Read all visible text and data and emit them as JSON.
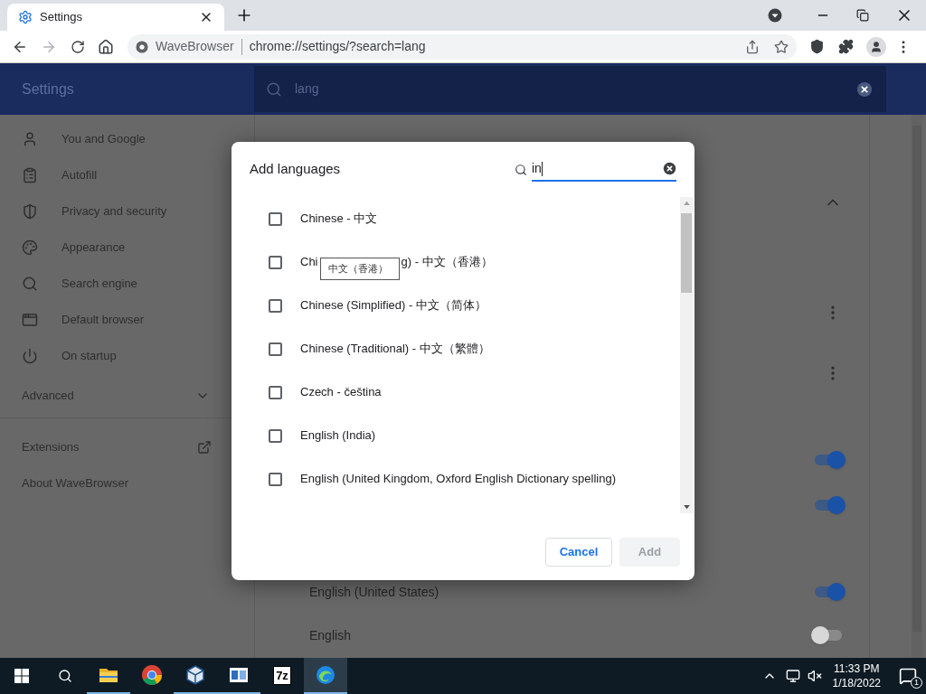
{
  "browser": {
    "tabs": [
      {
        "title": "Settings",
        "selected": true
      }
    ],
    "site_name": "WaveBrowser",
    "url": "chrome://settings/?search=lang"
  },
  "settings_header": {
    "title": "Settings",
    "search_value": "lang"
  },
  "sidebar": {
    "items": [
      {
        "label": "You and Google",
        "kind": "person"
      },
      {
        "label": "Autofill",
        "kind": "clipboard"
      },
      {
        "label": "Privacy and security",
        "kind": "shield"
      },
      {
        "label": "Appearance",
        "kind": "palette"
      },
      {
        "label": "Search engine",
        "kind": "search"
      },
      {
        "label": "Default browser",
        "kind": "browser"
      },
      {
        "label": "On startup",
        "kind": "power"
      }
    ],
    "advanced": {
      "label": "Advanced",
      "expanded": false
    },
    "links": [
      {
        "label": "Extensions",
        "external": true
      },
      {
        "label": "About WaveBrowser",
        "external": false
      }
    ]
  },
  "background_rows": [
    {
      "kind": "collapse"
    },
    {
      "kind": "menu"
    },
    {
      "kind": "menu"
    },
    {
      "kind": "toggle",
      "on": true
    },
    {
      "kind": "toggle",
      "on": true
    },
    {
      "kind": "toggle",
      "label": "English (United States)",
      "on": true
    },
    {
      "kind": "toggle",
      "label": "English",
      "on": false
    }
  ],
  "dialog": {
    "title": "Add languages",
    "search_value": "in",
    "languages": [
      {
        "label": "Chinese - 中文",
        "checked": false
      },
      {
        "label_start": "Chi",
        "tooltip": "中文（香港）",
        "label_end": "g) - 中文（香港）",
        "checked": false
      },
      {
        "label": "Chinese (Simplified) - 中文（简体）",
        "checked": false
      },
      {
        "label": "Chinese (Traditional) - 中文（繁體）",
        "checked": false
      },
      {
        "label": "Czech - čeština",
        "checked": false
      },
      {
        "label": "English (India)",
        "checked": false
      },
      {
        "label": "English (United Kingdom, Oxford English Dictionary spelling)",
        "checked": false
      }
    ],
    "buttons": [
      {
        "label": "Cancel",
        "kind": "secondary",
        "disabled": false
      },
      {
        "label": "Add",
        "kind": "primary",
        "disabled": true
      }
    ]
  },
  "taskbar": {
    "apps": [
      {
        "kind": "explorer",
        "running": true,
        "selected": false
      },
      {
        "kind": "chrome",
        "running": false,
        "selected": false
      },
      {
        "kind": "cube",
        "running": true,
        "selected": false
      },
      {
        "kind": "window",
        "running": true,
        "selected": false
      },
      {
        "kind": "archiver",
        "label": "7z",
        "running": false,
        "selected": false
      },
      {
        "kind": "wave",
        "running": true,
        "selected": true
      }
    ],
    "time": "11:33 PM",
    "date": "1/18/2022",
    "notification_count": "1"
  }
}
